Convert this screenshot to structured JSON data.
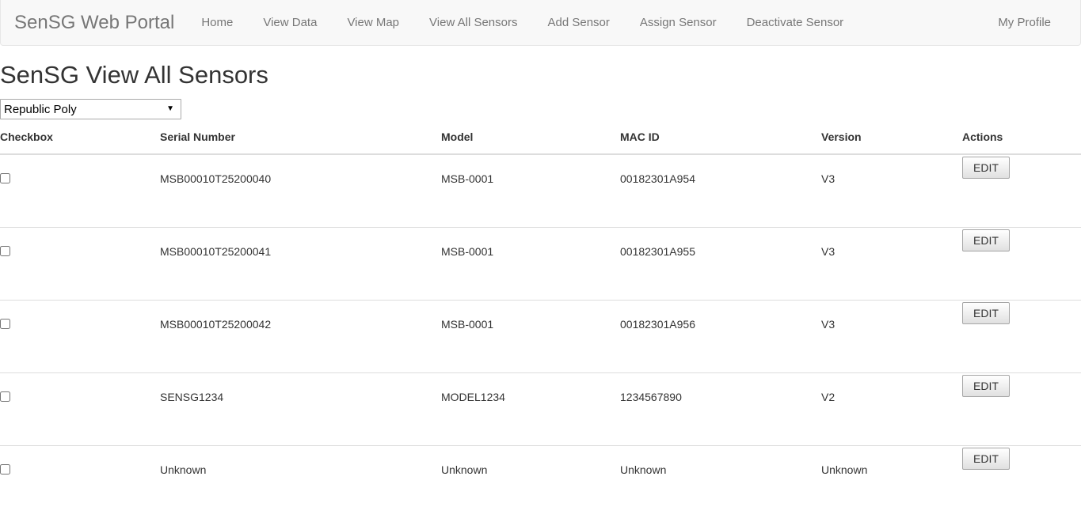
{
  "navbar": {
    "brand": "SenSG Web Portal",
    "links": [
      {
        "label": "Home",
        "name": "nav-home"
      },
      {
        "label": "View Data",
        "name": "nav-view-data"
      },
      {
        "label": "View Map",
        "name": "nav-view-map"
      },
      {
        "label": "View All Sensors",
        "name": "nav-view-all-sensors"
      },
      {
        "label": "Add Sensor",
        "name": "nav-add-sensor"
      },
      {
        "label": "Assign Sensor",
        "name": "nav-assign-sensor"
      },
      {
        "label": "Deactivate Sensor",
        "name": "nav-deactivate-sensor"
      }
    ],
    "right_links": [
      {
        "label": "My Profile",
        "name": "nav-my-profile"
      }
    ]
  },
  "page": {
    "title": "SenSG View All Sensors"
  },
  "org_select": {
    "selected": "Republic Poly",
    "options": [
      "Republic Poly"
    ],
    "arrow_glyph": "▼"
  },
  "table": {
    "headers": [
      "Checkbox",
      "Serial Number",
      "Model",
      "MAC ID",
      "Version",
      "Actions"
    ],
    "edit_label": "EDIT",
    "rows": [
      {
        "checked": false,
        "serial": "MSB00010T25200040",
        "model": "MSB-0001",
        "mac": "00182301A954",
        "version": "V3"
      },
      {
        "checked": false,
        "serial": "MSB00010T25200041",
        "model": "MSB-0001",
        "mac": "00182301A955",
        "version": "V3"
      },
      {
        "checked": false,
        "serial": "MSB00010T25200042",
        "model": "MSB-0001",
        "mac": "00182301A956",
        "version": "V3"
      },
      {
        "checked": false,
        "serial": "SENSG1234",
        "model": "MODEL1234",
        "mac": "1234567890",
        "version": "V2"
      },
      {
        "checked": false,
        "serial": "Unknown",
        "model": "Unknown",
        "mac": "Unknown",
        "version": "Unknown"
      }
    ]
  },
  "colors": {
    "navbar_bg": "#f8f8f8",
    "navbar_border": "#e7e7e7",
    "nav_text": "#777777",
    "body_text": "#333333",
    "table_border": "#dddddd",
    "page_bg": "#ffffff"
  }
}
